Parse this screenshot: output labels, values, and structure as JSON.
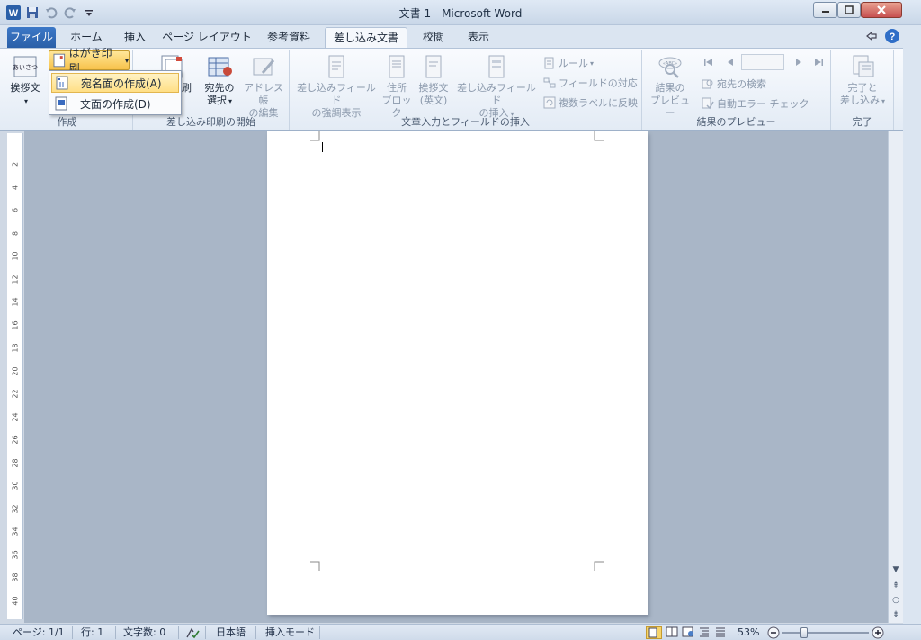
{
  "window": {
    "title": "文書 1 - Microsoft Word",
    "app_icon_letter": "W"
  },
  "tabs": {
    "file": "ファイル",
    "home": "ホーム",
    "insert": "挿入",
    "page_layout": "ページ レイアウト",
    "references": "参考資料",
    "mailings": "差し込み文書",
    "review": "校閲",
    "view": "表示"
  },
  "ribbon": {
    "create_group": {
      "label": "作成",
      "greeting_button": "挨拶文",
      "greeting_icon_text": "あいさつ",
      "hagaki_button": "はがき印刷"
    },
    "start_group": {
      "label": "差し込み印刷の開始",
      "print_button": "印刷",
      "select_recipients_line1": "宛先の",
      "select_recipients_line2": "選択",
      "address_book_line1": "アドレス帳",
      "address_book_line2": "の編集"
    },
    "fields_group": {
      "label": "文章入力とフィールドの挿入",
      "highlight_line1": "差し込みフィールド",
      "highlight_line2": "の強調表示",
      "address_block_line1": "住所",
      "address_block_line2": "ブロック",
      "greeting_en_line1": "挨拶文",
      "greeting_en_line2": "(英文)",
      "insert_field_line1": "差し込みフィールド",
      "insert_field_line2": "の挿入",
      "rules": "ルール",
      "match_fields": "フィールドの対応",
      "update_labels": "複数ラベルに反映"
    },
    "preview_group": {
      "label": "結果のプレビュー",
      "preview_line1": "結果の",
      "preview_line2": "プレビュー",
      "find_recipient": "宛先の検索",
      "auto_check": "自動エラー チェック",
      "preview_icon_text": "«ABC»"
    },
    "finish_group": {
      "label": "完了",
      "finish_line1": "完了と",
      "finish_line2": "差し込み"
    }
  },
  "dropdown": {
    "address_side": "宛名面の作成(A)",
    "body_side": "文面の作成(D)"
  },
  "ruler_ticks": [
    "2",
    "4",
    "6",
    "8",
    "10",
    "12",
    "14",
    "16",
    "18",
    "20",
    "22",
    "24",
    "26",
    "28",
    "30",
    "32",
    "34",
    "36",
    "38",
    "40"
  ],
  "statusbar": {
    "page": "ページ: 1/1",
    "line": "行: 1",
    "chars": "文字数: 0",
    "language": "日本語",
    "mode": "挿入モード",
    "zoom": "53%"
  }
}
